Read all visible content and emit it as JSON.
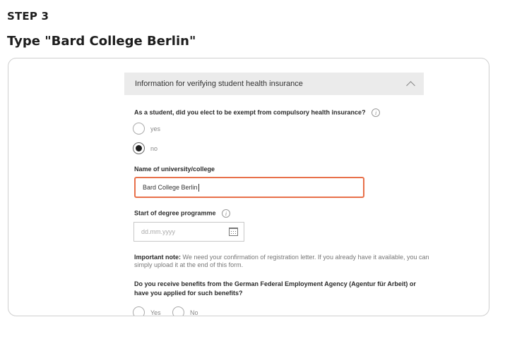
{
  "header": {
    "step": "STEP 3",
    "instruction": "Type \"Bard College Berlin\""
  },
  "section": {
    "title": "Information for verifying student health insurance"
  },
  "exemption": {
    "question": "As a student, did you elect to be exempt from compulsory health insurance?",
    "info_icon": "i",
    "options": [
      "yes",
      "no"
    ],
    "selected": "no"
  },
  "university": {
    "label": "Name of university/college",
    "value": "Bard College Berlin"
  },
  "degree_start": {
    "label": "Start of degree programme",
    "info_icon": "i",
    "placeholder": "dd.mm.yyyy"
  },
  "note": {
    "bold": "Important note:",
    "text": " We need your confirmation of registration letter. If you already have it available, you can simply upload it at the end of this form."
  },
  "benefits": {
    "question": "Do you receive benefits from the German Federal Employment Agency (Agentur für Arbeit) or have you applied for such benefits?",
    "options": [
      "Yes",
      "No"
    ]
  },
  "colors": {
    "focus_border": "#e8704a",
    "section_bg": "#ebebeb"
  }
}
